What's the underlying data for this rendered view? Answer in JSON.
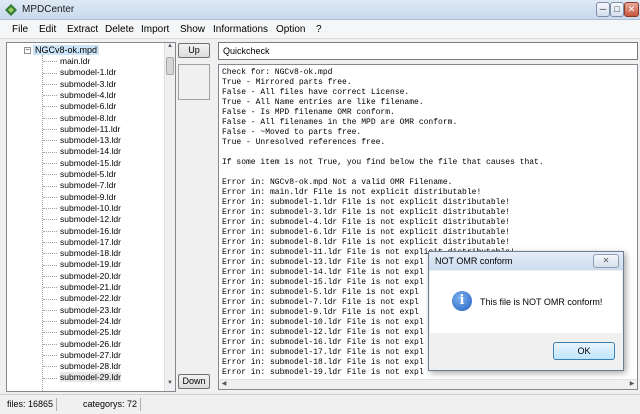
{
  "window": {
    "title": "MPDCenter"
  },
  "menu": [
    "File",
    "Edit",
    "Extract",
    "Delete",
    "Import",
    "Show",
    "Informations",
    "Option",
    "?"
  ],
  "tree": {
    "root": "NGCv8-ok.mpd",
    "items": [
      "main.ldr",
      "submodel-1.ldr",
      "submodel-3.ldr",
      "submodel-4.ldr",
      "submodel-6.ldr",
      "submodel-8.ldr",
      "submodel-11.ldr",
      "submodel-13.ldr",
      "submodel-14.ldr",
      "submodel-15.ldr",
      "submodel-5.ldr",
      "submodel-7.ldr",
      "submodel-9.ldr",
      "submodel-10.ldr",
      "submodel-12.ldr",
      "submodel-16.ldr",
      "submodel-17.ldr",
      "submodel-18.ldr",
      "submodel-19.ldr",
      "submodel-20.ldr",
      "submodel-21.ldr",
      "submodel-22.ldr",
      "submodel-23.ldr",
      "submodel-24.ldr",
      "submodel-25.ldr",
      "submodel-26.ldr",
      "submodel-27.ldr",
      "submodel-28.ldr",
      "submodel-29.ldr"
    ]
  },
  "buttons": {
    "up": "Up",
    "down": "Down"
  },
  "quickcheck": {
    "value": "Quickcheck"
  },
  "report": {
    "lines": [
      "Check for: NGCv8-ok.mpd",
      "True - Mirrored parts free.",
      "False - All files have correct License.",
      "True - All Name entries are like filename.",
      "False - Is MPD filename OMR conform.",
      "False - All filenames in the MPD are OMR conform.",
      "False - ~Moved to parts free.",
      "True - Unresolved references free.",
      "",
      "If some item is not True, you find below the file that causes that.",
      "",
      "Error in: NGCv8-ok.mpd Not a valid OMR Filename.",
      "Error in: main.ldr File is not explicit distributable!",
      "Error in: submodel-1.ldr File is not explicit distributable!",
      "Error in: submodel-3.ldr File is not explicit distributable!",
      "Error in: submodel-4.ldr File is not explicit distributable!",
      "Error in: submodel-6.ldr File is not explicit distributable!",
      "Error in: submodel-8.ldr File is not explicit distributable!",
      "Error in: submodel-11.ldr File is not explicit distributable!",
      "Error in: submodel-13.ldr File is not expl",
      "Error in: submodel-14.ldr File is not expl",
      "Error in: submodel-15.ldr File is not expl",
      "Error in: submodel-5.ldr File is not expl",
      "Error in: submodel-7.ldr File is not expl",
      "Error in: submodel-9.ldr File is not expl",
      "Error in: submodel-10.ldr File is not expl",
      "Error in: submodel-12.ldr File is not expl",
      "Error in: submodel-16.ldr File is not expl",
      "Error in: submodel-17.ldr File is not expl",
      "Error in: submodel-18.ldr File is not expl",
      "Error in: submodel-19.ldr File is not expl"
    ]
  },
  "status": {
    "files": "files: 16865",
    "categorys": "categorys: 72"
  },
  "dialog": {
    "title": "NOT OMR conform",
    "message": "This file is NOT OMR conform!",
    "ok": "OK",
    "close_glyph": "✕",
    "icon": "info-icon"
  },
  "icons": {
    "min": "─",
    "max": "□",
    "close": "✕",
    "minus": "−",
    "up_arrow": "▲",
    "down_arrow": "▼",
    "left_arrow": "◀",
    "right_arrow": "▶",
    "info": "i"
  }
}
